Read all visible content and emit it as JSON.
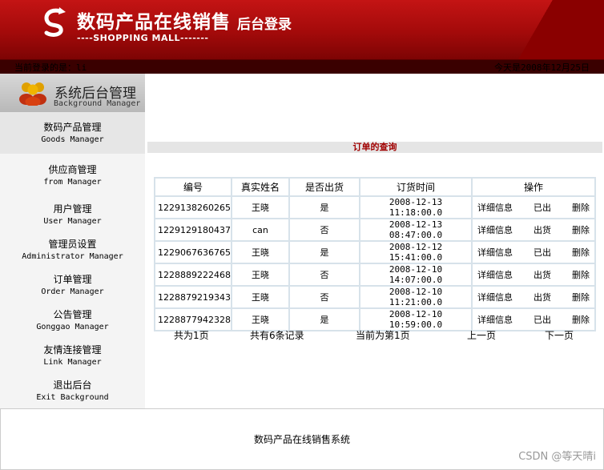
{
  "header": {
    "title": "数码产品在线销售",
    "subtitle": "后台登录",
    "english": "----SHOPPING MALL-------"
  },
  "infobar": {
    "login_user": "当前登录的是：li",
    "today": "今天是2008年12月25日"
  },
  "sidebar": {
    "title_cn": "系统后台管理",
    "title_en": "Background Manager",
    "items": [
      {
        "cn": "数码产品管理",
        "en": "Goods Manager"
      },
      {
        "cn": "供应商管理",
        "en": "from Manager"
      },
      {
        "cn": "用户管理",
        "en": "User Manager"
      },
      {
        "cn": "管理员设置",
        "en": "Administrator Manager"
      },
      {
        "cn": "订单管理",
        "en": "Order Manager"
      },
      {
        "cn": "公告管理",
        "en": "Gonggao Manager"
      },
      {
        "cn": "友情连接管理",
        "en": "Link Manager"
      },
      {
        "cn": "退出后台",
        "en": "Exit Background"
      }
    ]
  },
  "main": {
    "section_title": "订单的查询",
    "columns": [
      "编号",
      "真实姓名",
      "是否出货",
      "订货时间",
      "操作"
    ],
    "rows": [
      {
        "code": "1229138260265",
        "name": "王晓",
        "shipped": "是",
        "time": "2008-12-13 11:18:00.0",
        "detail": "详细信息",
        "action": "已出",
        "delete": "删除"
      },
      {
        "code": "1229129180437",
        "name": "can",
        "shipped": "否",
        "time": "2008-12-13 08:47:00.0",
        "detail": "详细信息",
        "action": "出货",
        "delete": "删除"
      },
      {
        "code": "1229067636765",
        "name": "王晓",
        "shipped": "是",
        "time": "2008-12-12 15:41:00.0",
        "detail": "详细信息",
        "action": "已出",
        "delete": "删除"
      },
      {
        "code": "1228889222468",
        "name": "王晓",
        "shipped": "否",
        "time": "2008-12-10 14:07:00.0",
        "detail": "详细信息",
        "action": "出货",
        "delete": "删除"
      },
      {
        "code": "1228879219343",
        "name": "王晓",
        "shipped": "否",
        "time": "2008-12-10 11:21:00.0",
        "detail": "详细信息",
        "action": "出货",
        "delete": "删除"
      },
      {
        "code": "1228877942328",
        "name": "王晓",
        "shipped": "是",
        "time": "2008-12-10 10:59:00.0",
        "detail": "详细信息",
        "action": "已出",
        "delete": "删除"
      }
    ],
    "pager": {
      "total_pages": "共为1页",
      "total_records": "共有6条记录",
      "current": "当前为第1页",
      "prev": "上一页",
      "next": "下一页"
    }
  },
  "footer": {
    "text": "数码产品在线销售系统",
    "watermark": "CSDN @等天晴i"
  },
  "colors": {
    "header_red": "#b00e0e",
    "section_title": "#a00000",
    "table_border": "#d7e2ea"
  }
}
